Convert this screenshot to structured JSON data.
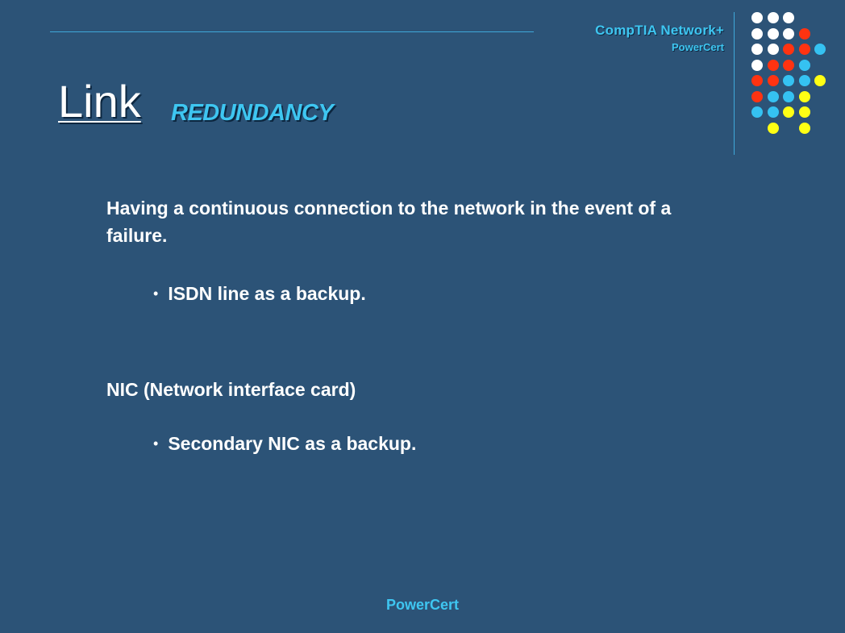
{
  "header": {
    "brand": "CompTIA Network+",
    "brand_sub": "PowerCert"
  },
  "title": {
    "main": "Link",
    "sub": "REDUNDANCY"
  },
  "body": {
    "para1": "Having a continuous connection to the network in the event of a failure.",
    "bullet1": "ISDN line as a backup.",
    "para2": "NIC (Network interface card)",
    "bullet2": "Secondary NIC as a backup."
  },
  "footer": {
    "text": "PowerCert"
  },
  "colors": {
    "background": "#2c5377",
    "accent": "#3ec6f1",
    "dot_white": "#ffffff",
    "dot_red": "#ff3311",
    "dot_blue": "#35c2f2",
    "dot_yellow": "#ffff14"
  },
  "decor": {
    "dot_rows": [
      [
        "white",
        "white",
        "white"
      ],
      [
        "white",
        "white",
        "white",
        "red"
      ],
      [
        "white",
        "white",
        "red",
        "red",
        "blue"
      ],
      [
        "white",
        "red",
        "red",
        "blue"
      ],
      [
        "red",
        "red",
        "blue",
        "blue",
        "yellow"
      ],
      [
        "red",
        "blue",
        "blue",
        "yellow"
      ],
      [
        "blue",
        "blue",
        "yellow",
        "yellow"
      ],
      [
        "yellow",
        "yellow"
      ]
    ]
  }
}
